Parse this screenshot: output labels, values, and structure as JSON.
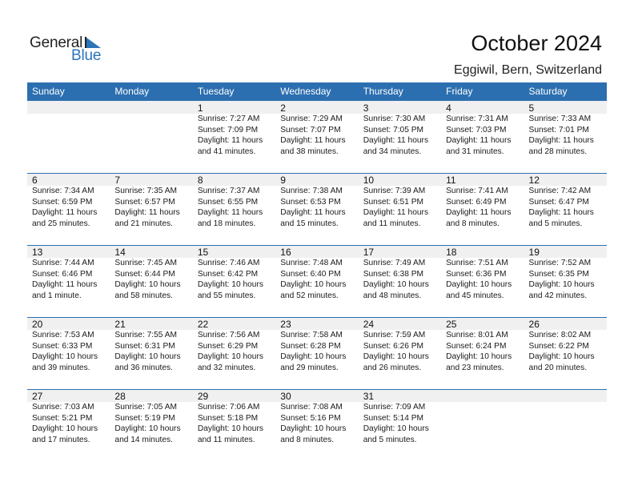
{
  "logo": {
    "general": "General",
    "blue": "Blue",
    "brand_color": "#2a74b8"
  },
  "header": {
    "title": "October 2024",
    "location": "Eggiwil, Bern, Switzerland"
  },
  "colors": {
    "header_bg": "#2c6fb0",
    "strip_bg": "#f0f0f0"
  },
  "weekdays": [
    "Sunday",
    "Monday",
    "Tuesday",
    "Wednesday",
    "Thursday",
    "Friday",
    "Saturday"
  ],
  "weeks": [
    [
      null,
      null,
      {
        "day": "1",
        "sunrise": "Sunrise: 7:27 AM",
        "sunset": "Sunset: 7:09 PM",
        "daylight1": "Daylight: 11 hours",
        "daylight2": "and 41 minutes."
      },
      {
        "day": "2",
        "sunrise": "Sunrise: 7:29 AM",
        "sunset": "Sunset: 7:07 PM",
        "daylight1": "Daylight: 11 hours",
        "daylight2": "and 38 minutes."
      },
      {
        "day": "3",
        "sunrise": "Sunrise: 7:30 AM",
        "sunset": "Sunset: 7:05 PM",
        "daylight1": "Daylight: 11 hours",
        "daylight2": "and 34 minutes."
      },
      {
        "day": "4",
        "sunrise": "Sunrise: 7:31 AM",
        "sunset": "Sunset: 7:03 PM",
        "daylight1": "Daylight: 11 hours",
        "daylight2": "and 31 minutes."
      },
      {
        "day": "5",
        "sunrise": "Sunrise: 7:33 AM",
        "sunset": "Sunset: 7:01 PM",
        "daylight1": "Daylight: 11 hours",
        "daylight2": "and 28 minutes."
      }
    ],
    [
      {
        "day": "6",
        "sunrise": "Sunrise: 7:34 AM",
        "sunset": "Sunset: 6:59 PM",
        "daylight1": "Daylight: 11 hours",
        "daylight2": "and 25 minutes."
      },
      {
        "day": "7",
        "sunrise": "Sunrise: 7:35 AM",
        "sunset": "Sunset: 6:57 PM",
        "daylight1": "Daylight: 11 hours",
        "daylight2": "and 21 minutes."
      },
      {
        "day": "8",
        "sunrise": "Sunrise: 7:37 AM",
        "sunset": "Sunset: 6:55 PM",
        "daylight1": "Daylight: 11 hours",
        "daylight2": "and 18 minutes."
      },
      {
        "day": "9",
        "sunrise": "Sunrise: 7:38 AM",
        "sunset": "Sunset: 6:53 PM",
        "daylight1": "Daylight: 11 hours",
        "daylight2": "and 15 minutes."
      },
      {
        "day": "10",
        "sunrise": "Sunrise: 7:39 AM",
        "sunset": "Sunset: 6:51 PM",
        "daylight1": "Daylight: 11 hours",
        "daylight2": "and 11 minutes."
      },
      {
        "day": "11",
        "sunrise": "Sunrise: 7:41 AM",
        "sunset": "Sunset: 6:49 PM",
        "daylight1": "Daylight: 11 hours",
        "daylight2": "and 8 minutes."
      },
      {
        "day": "12",
        "sunrise": "Sunrise: 7:42 AM",
        "sunset": "Sunset: 6:47 PM",
        "daylight1": "Daylight: 11 hours",
        "daylight2": "and 5 minutes."
      }
    ],
    [
      {
        "day": "13",
        "sunrise": "Sunrise: 7:44 AM",
        "sunset": "Sunset: 6:46 PM",
        "daylight1": "Daylight: 11 hours",
        "daylight2": "and 1 minute."
      },
      {
        "day": "14",
        "sunrise": "Sunrise: 7:45 AM",
        "sunset": "Sunset: 6:44 PM",
        "daylight1": "Daylight: 10 hours",
        "daylight2": "and 58 minutes."
      },
      {
        "day": "15",
        "sunrise": "Sunrise: 7:46 AM",
        "sunset": "Sunset: 6:42 PM",
        "daylight1": "Daylight: 10 hours",
        "daylight2": "and 55 minutes."
      },
      {
        "day": "16",
        "sunrise": "Sunrise: 7:48 AM",
        "sunset": "Sunset: 6:40 PM",
        "daylight1": "Daylight: 10 hours",
        "daylight2": "and 52 minutes."
      },
      {
        "day": "17",
        "sunrise": "Sunrise: 7:49 AM",
        "sunset": "Sunset: 6:38 PM",
        "daylight1": "Daylight: 10 hours",
        "daylight2": "and 48 minutes."
      },
      {
        "day": "18",
        "sunrise": "Sunrise: 7:51 AM",
        "sunset": "Sunset: 6:36 PM",
        "daylight1": "Daylight: 10 hours",
        "daylight2": "and 45 minutes."
      },
      {
        "day": "19",
        "sunrise": "Sunrise: 7:52 AM",
        "sunset": "Sunset: 6:35 PM",
        "daylight1": "Daylight: 10 hours",
        "daylight2": "and 42 minutes."
      }
    ],
    [
      {
        "day": "20",
        "sunrise": "Sunrise: 7:53 AM",
        "sunset": "Sunset: 6:33 PM",
        "daylight1": "Daylight: 10 hours",
        "daylight2": "and 39 minutes."
      },
      {
        "day": "21",
        "sunrise": "Sunrise: 7:55 AM",
        "sunset": "Sunset: 6:31 PM",
        "daylight1": "Daylight: 10 hours",
        "daylight2": "and 36 minutes."
      },
      {
        "day": "22",
        "sunrise": "Sunrise: 7:56 AM",
        "sunset": "Sunset: 6:29 PM",
        "daylight1": "Daylight: 10 hours",
        "daylight2": "and 32 minutes."
      },
      {
        "day": "23",
        "sunrise": "Sunrise: 7:58 AM",
        "sunset": "Sunset: 6:28 PM",
        "daylight1": "Daylight: 10 hours",
        "daylight2": "and 29 minutes."
      },
      {
        "day": "24",
        "sunrise": "Sunrise: 7:59 AM",
        "sunset": "Sunset: 6:26 PM",
        "daylight1": "Daylight: 10 hours",
        "daylight2": "and 26 minutes."
      },
      {
        "day": "25",
        "sunrise": "Sunrise: 8:01 AM",
        "sunset": "Sunset: 6:24 PM",
        "daylight1": "Daylight: 10 hours",
        "daylight2": "and 23 minutes."
      },
      {
        "day": "26",
        "sunrise": "Sunrise: 8:02 AM",
        "sunset": "Sunset: 6:22 PM",
        "daylight1": "Daylight: 10 hours",
        "daylight2": "and 20 minutes."
      }
    ],
    [
      {
        "day": "27",
        "sunrise": "Sunrise: 7:03 AM",
        "sunset": "Sunset: 5:21 PM",
        "daylight1": "Daylight: 10 hours",
        "daylight2": "and 17 minutes."
      },
      {
        "day": "28",
        "sunrise": "Sunrise: 7:05 AM",
        "sunset": "Sunset: 5:19 PM",
        "daylight1": "Daylight: 10 hours",
        "daylight2": "and 14 minutes."
      },
      {
        "day": "29",
        "sunrise": "Sunrise: 7:06 AM",
        "sunset": "Sunset: 5:18 PM",
        "daylight1": "Daylight: 10 hours",
        "daylight2": "and 11 minutes."
      },
      {
        "day": "30",
        "sunrise": "Sunrise: 7:08 AM",
        "sunset": "Sunset: 5:16 PM",
        "daylight1": "Daylight: 10 hours",
        "daylight2": "and 8 minutes."
      },
      {
        "day": "31",
        "sunrise": "Sunrise: 7:09 AM",
        "sunset": "Sunset: 5:14 PM",
        "daylight1": "Daylight: 10 hours",
        "daylight2": "and 5 minutes."
      },
      null,
      null
    ]
  ]
}
